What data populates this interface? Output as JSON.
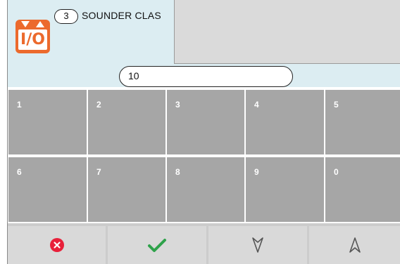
{
  "header": {
    "icon_label": "I/O",
    "zone_number": "3",
    "zone_label": "SOUNDER CLAS"
  },
  "input": {
    "value": "10"
  },
  "keypad": {
    "keys": [
      "1",
      "2",
      "3",
      "4",
      "5",
      "6",
      "7",
      "8",
      "9",
      "0"
    ]
  },
  "actions": {
    "items": [
      {
        "name": "cancel",
        "icon": "cancel-icon"
      },
      {
        "name": "confirm",
        "icon": "checkmark-icon"
      },
      {
        "name": "down",
        "icon": "arrow-down-icon"
      },
      {
        "name": "up",
        "icon": "arrow-up-icon"
      }
    ]
  },
  "colors": {
    "header_bg": "#dcedf2",
    "icon_orange": "#ec6a2d",
    "key_gray": "#a6a6a6",
    "cancel_red": "#e8203a",
    "confirm_green": "#2ea24a"
  }
}
